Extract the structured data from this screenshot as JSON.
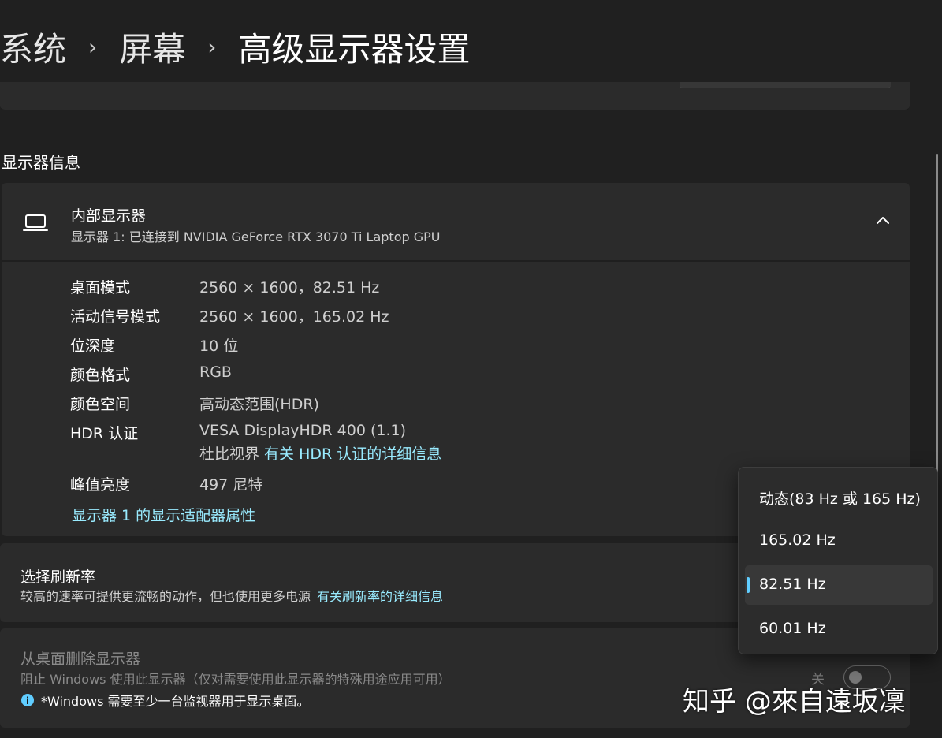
{
  "breadcrumb": {
    "items": [
      "系统",
      "屏幕"
    ],
    "current": "高级显示器设置",
    "separator": "›"
  },
  "section": {
    "title": "显示器信息"
  },
  "display": {
    "name": "内部显示器",
    "description": "显示器 1: 已连接到 NVIDIA GeForce RTX 3070 Ti Laptop GPU",
    "rows": [
      {
        "key": "桌面模式",
        "value": "2560 × 1600，82.51 Hz"
      },
      {
        "key": "活动信号模式",
        "value": "2560 × 1600，165.02 Hz"
      },
      {
        "key": "位深度",
        "value": "10 位"
      },
      {
        "key": "颜色格式",
        "value": "RGB"
      },
      {
        "key": "颜色空间",
        "value": "高动态范围(HDR)"
      },
      {
        "key": "HDR 认证",
        "value": "VESA DisplayHDR 400 (1.1)",
        "value2_prefix": "杜比视界 ",
        "value2_link": "有关 HDR 认证的详细信息"
      },
      {
        "key": "峰值亮度",
        "value": "497 尼特"
      }
    ],
    "adapter_link": "显示器 1 的显示适配器属性"
  },
  "refresh": {
    "title": "选择刷新率",
    "description": "较高的速率可提供更流畅的动作，但也使用更多电源",
    "link": "有关刷新率的详细信息",
    "options": [
      "动态(83 Hz 或 165 Hz)",
      "165.02 Hz",
      "82.51 Hz",
      "60.01 Hz"
    ],
    "selected_index": 2
  },
  "remove": {
    "title": "从桌面删除显示器",
    "description": "阻止 Windows 使用此显示器（仅对需要使用此显示器的特殊用途应用可用）",
    "note": "*Windows 需要至少一台监视器用于显示桌面。",
    "toggle_label": "关",
    "toggle_on": false
  },
  "watermark": "知乎 @來自遠坂凜",
  "colors": {
    "accent": "#60cdff",
    "link": "#99ebff",
    "card": "#2b2b2b",
    "background": "#202020"
  }
}
